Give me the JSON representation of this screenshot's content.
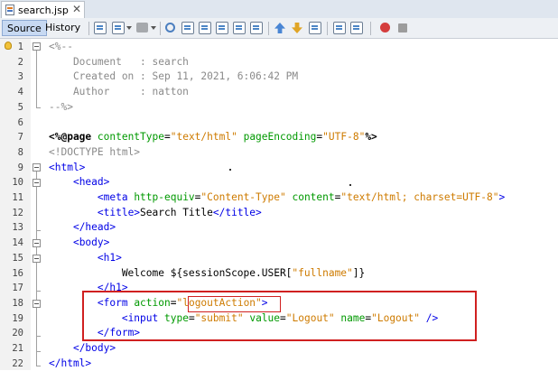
{
  "tab": {
    "filename": "search.jsp",
    "close": "✕"
  },
  "toolbar": {
    "source_label": "Source",
    "history_label": "History",
    "icons": [
      "last-edit-icon",
      "back-icon",
      "forward-icon",
      "find-icon",
      "find-previous-icon",
      "find-next-icon",
      "find-selection-icon",
      "toggle-highlight-icon",
      "previous-bookmark-icon",
      "next-bookmark-icon",
      "toggle-bookmark-icon",
      "shift-left-icon",
      "shift-right-icon",
      "start-macro-icon",
      "stop-macro-icon"
    ]
  },
  "lines": [
    {
      "n": "1",
      "parts": [
        [
          "cm",
          "<%--"
        ]
      ]
    },
    {
      "n": "2",
      "parts": [
        [
          "cm",
          "    Document   : search"
        ]
      ]
    },
    {
      "n": "3",
      "parts": [
        [
          "cm",
          "    Created on : Sep 11, 2021, 6:06:42 PM"
        ]
      ]
    },
    {
      "n": "4",
      "parts": [
        [
          "cm",
          "    Author     : natton"
        ]
      ]
    },
    {
      "n": "5",
      "parts": [
        [
          "cm",
          "--%>"
        ]
      ]
    },
    {
      "n": "6",
      "parts": []
    },
    {
      "n": "7",
      "parts": [
        [
          "dir",
          "<%@page "
        ],
        [
          "attr",
          "contentType"
        ],
        [
          "el",
          "="
        ],
        [
          "str",
          "\"text/html\""
        ],
        [
          "el",
          " "
        ],
        [
          "attr",
          "pageEncoding"
        ],
        [
          "el",
          "="
        ],
        [
          "str",
          "\"UTF-8\""
        ],
        [
          "dir",
          "%>"
        ]
      ]
    },
    {
      "n": "8",
      "parts": [
        [
          "cm",
          "<!DOCTYPE html>"
        ]
      ]
    },
    {
      "n": "9",
      "parts": [
        [
          "tag",
          "<html>"
        ]
      ]
    },
    {
      "n": "10",
      "parts": [
        [
          "el",
          "    "
        ],
        [
          "tag",
          "<head>"
        ]
      ]
    },
    {
      "n": "11",
      "parts": [
        [
          "el",
          "        "
        ],
        [
          "tag",
          "<meta "
        ],
        [
          "attr",
          "http-equiv"
        ],
        [
          "el",
          "="
        ],
        [
          "str",
          "\"Content-Type\""
        ],
        [
          "el",
          " "
        ],
        [
          "attr",
          "content"
        ],
        [
          "el",
          "="
        ],
        [
          "str",
          "\"text/html; charset=UTF-8\""
        ],
        [
          "tag",
          ">"
        ]
      ]
    },
    {
      "n": "12",
      "parts": [
        [
          "el",
          "        "
        ],
        [
          "tag",
          "<title>"
        ],
        [
          "el",
          "Search Title"
        ],
        [
          "tag",
          "</title>"
        ]
      ]
    },
    {
      "n": "13",
      "parts": [
        [
          "el",
          "    "
        ],
        [
          "tag",
          "</head>"
        ]
      ]
    },
    {
      "n": "14",
      "parts": [
        [
          "el",
          "    "
        ],
        [
          "tag",
          "<body>"
        ]
      ]
    },
    {
      "n": "15",
      "parts": [
        [
          "el",
          "        "
        ],
        [
          "tag",
          "<h1>"
        ]
      ]
    },
    {
      "n": "16",
      "parts": [
        [
          "el",
          "            Welcome ${sessionScope.USER["
        ],
        [
          "str",
          "\"fullname\""
        ],
        [
          "el",
          "]}"
        ]
      ]
    },
    {
      "n": "17",
      "parts": [
        [
          "el",
          "        "
        ],
        [
          "tag",
          "</h1>"
        ]
      ]
    },
    {
      "n": "18",
      "parts": [
        [
          "el",
          "        "
        ],
        [
          "tag",
          "<form "
        ],
        [
          "attr",
          "action"
        ],
        [
          "el",
          "="
        ],
        [
          "str",
          "\"logoutAction\""
        ],
        [
          "tag",
          ">"
        ]
      ]
    },
    {
      "n": "19",
      "parts": [
        [
          "el",
          "            "
        ],
        [
          "tag",
          "<input "
        ],
        [
          "attr",
          "type"
        ],
        [
          "el",
          "="
        ],
        [
          "str",
          "\"submit\""
        ],
        [
          "el",
          " "
        ],
        [
          "attr",
          "value"
        ],
        [
          "el",
          "="
        ],
        [
          "str",
          "\"Logout\""
        ],
        [
          "el",
          " "
        ],
        [
          "attr",
          "name"
        ],
        [
          "el",
          "="
        ],
        [
          "str",
          "\"Logout\""
        ],
        [
          "el",
          " "
        ],
        [
          "tag",
          "/>"
        ]
      ]
    },
    {
      "n": "20",
      "parts": [
        [
          "el",
          "        "
        ],
        [
          "tag",
          "</form>"
        ]
      ]
    },
    {
      "n": "21",
      "parts": [
        [
          "el",
          "    "
        ],
        [
          "tag",
          "</body>"
        ]
      ]
    },
    {
      "n": "22",
      "parts": [
        [
          "tag",
          "</html>"
        ]
      ]
    }
  ],
  "colors": {
    "comment": "#8a8a8a",
    "tag": "#0000e6",
    "attribute": "#009900",
    "string": "#ce7b00",
    "highlight_box": "#d02020"
  }
}
